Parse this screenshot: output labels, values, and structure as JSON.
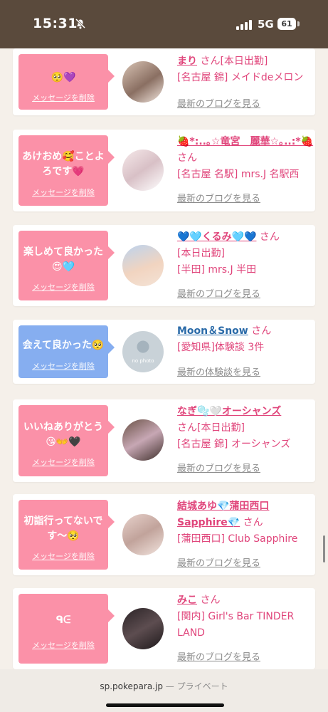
{
  "status_bar": {
    "time": "15:31",
    "network": "5G",
    "battery": "61"
  },
  "cards": [
    {
      "message": "🥺💜",
      "delete_label": "メッセージを削除",
      "name": "まり",
      "suffix": "さん[本日出勤]",
      "details": [
        "[名古屋 錦] メイドdeメロン"
      ],
      "link": "最新のブログを見る",
      "bubble_color": "#fb91a8"
    },
    {
      "message": "あけおめ🥰ことよろです💗",
      "delete_label": "メッセージを削除",
      "name": "🍓*:..｡☆竜宮　麗華☆｡..:*🍓",
      "suffix": "さん",
      "details": [
        "[名古屋 名駅] mrs.J 名駅西"
      ],
      "link": "最新のブログを見る",
      "bubble_color": "#fb91a8"
    },
    {
      "message": "楽しめて良かった😍🩵",
      "delete_label": "メッセージを削除",
      "name": "💙🩵くるみ🩵💙",
      "suffix": "さん",
      "details": [
        "[本日出勤]",
        "[半田] mrs.J 半田"
      ],
      "link": "最新のブログを見る",
      "bubble_color": "#fb91a8"
    },
    {
      "message": "会えて良かった🥺",
      "delete_label": "メッセージを削除",
      "name": "Moon＆Snow",
      "suffix": "さん",
      "details": [
        "[愛知県]体験談 3件"
      ],
      "link": "最新の体験談を見る",
      "bubble_color": "#86aef0",
      "avatar_text": "no photo"
    },
    {
      "message": "いいねありがとう😘👐🖤",
      "delete_label": "メッセージを削除",
      "name": "なぎ🫧🤍オーシャンズ",
      "suffix": "さん[本日出勤]",
      "details": [
        "[名古屋 錦] オーシャンズ"
      ],
      "link": "最新のブログを見る",
      "bubble_color": "#fb91a8"
    },
    {
      "message": "初詣行ってないです〜🥺",
      "delete_label": "メッセージを削除",
      "name": "結城あゆ💎蒲田西口Sapphire💎",
      "suffix": "さん",
      "details": [
        "[蒲田西口] Club Sapphire"
      ],
      "link": "最新のブログを見る",
      "bubble_color": "#fb91a8"
    },
    {
      "message": "ᑫᕮ",
      "delete_label": "メッセージを削除",
      "name": "みこ",
      "suffix": "さん",
      "details": [
        "[関内] Girl's Bar TINDER LAND"
      ],
      "link": "最新のブログを見る",
      "bubble_color": "#fb91a8"
    }
  ],
  "browser": {
    "domain": "sp.pokepara.jp",
    "mode": "— プライベート"
  }
}
